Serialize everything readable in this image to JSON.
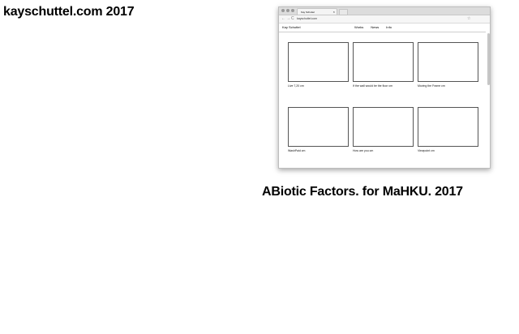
{
  "slide": {
    "title": "kayschuttel.com 2017",
    "caption": "ABiotic Factors. for MaHKU. 2017"
  },
  "browser": {
    "tab_title": "Kay Schuttel",
    "tab_close": "×",
    "url": "kayschuttel.com",
    "back_glyph": "←",
    "forward_glyph": "→",
    "reload_glyph": "C",
    "star_glyph": "☆"
  },
  "site": {
    "name": "Kay Schuttel",
    "nav": [
      "Works",
      "News",
      "Info"
    ],
    "works": [
      "Live 7,20 cm",
      "If the wall would be the floor cm",
      "Moving the Frame cm",
      "WashPaid cm",
      "How are you cm",
      "Viewpoint cm"
    ]
  }
}
